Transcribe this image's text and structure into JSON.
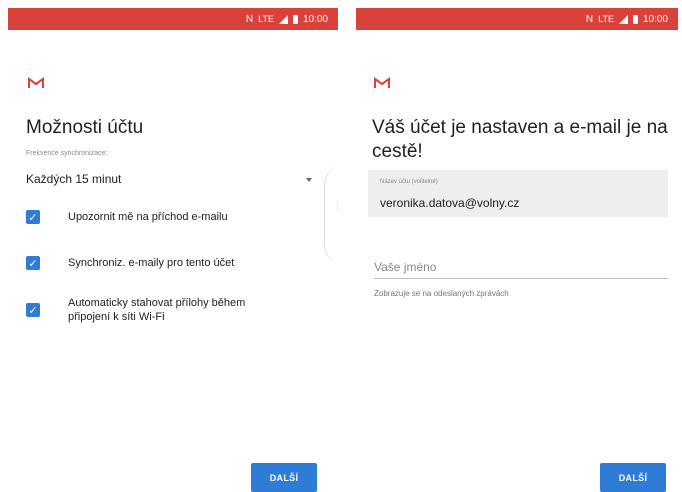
{
  "status_bar": {
    "time": "10:00",
    "network": "N",
    "signal_label": "LTE"
  },
  "left": {
    "title": "Možnosti účtu",
    "sync_label": "Frekvence synchronizace:",
    "sync_value": "Každých 15 minut",
    "checkboxes": [
      {
        "label": "Upozornit mě na příchod e-mailu",
        "checked": true
      },
      {
        "label": "Synchroniz. e-maily pro tento účet",
        "checked": true
      },
      {
        "label": "Automaticky stahovat přílohy během připojení k síti Wi-Fi",
        "checked": true
      }
    ],
    "next_button": "DALŠÍ"
  },
  "right": {
    "title": "Váš účet je nastaven a e-mail je na cestě!",
    "account_name_label": "Název účtu (volitelné)",
    "account_name_value": "veronika.datova@volny.cz",
    "your_name_placeholder": "Vaše jméno",
    "helper": "Zobrazuje se na odeslaných zprávách",
    "next_button": "DALŠÍ"
  },
  "colors": {
    "status_bar": "#d9423a",
    "accent": "#2f7cd6",
    "gmail_red": "#d9423a"
  },
  "icons": [
    "gmail-icon",
    "checkbox-checked-icon",
    "dropdown-caret-icon",
    "signal-icon",
    "battery-icon"
  ]
}
